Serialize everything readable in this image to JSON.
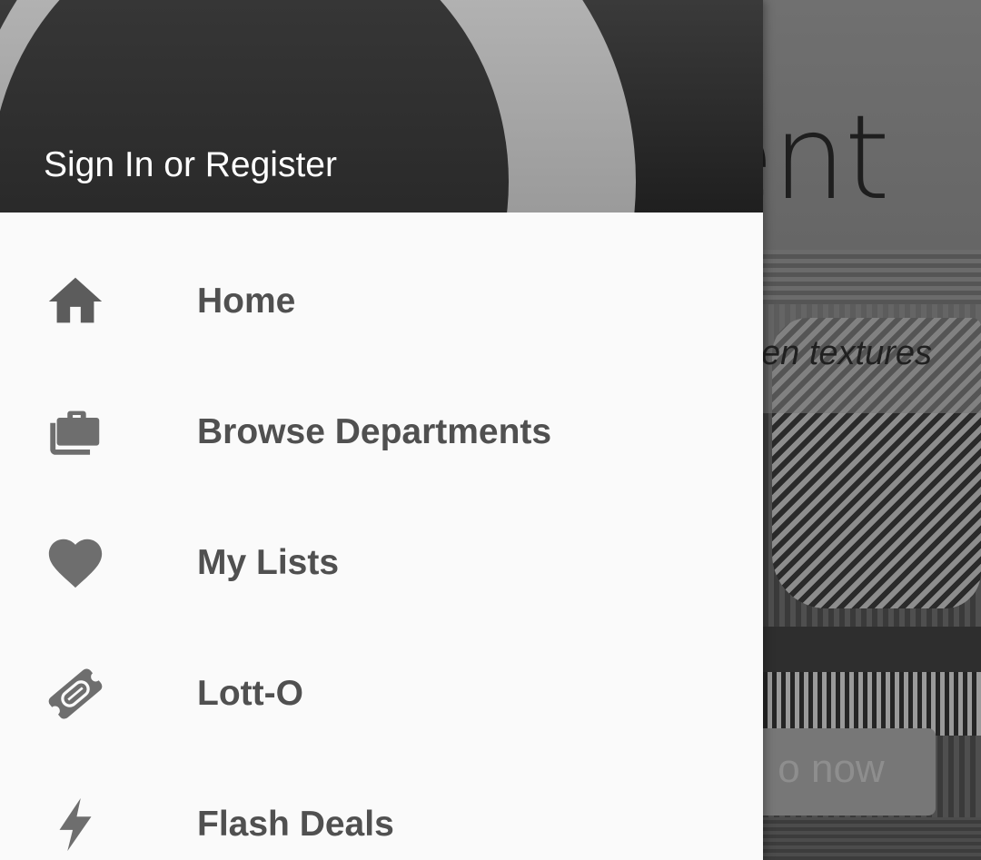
{
  "drawer": {
    "header": {
      "signin_label": "Sign In or Register"
    },
    "items": [
      {
        "label": "Home",
        "icon": "home-icon"
      },
      {
        "label": "Browse Departments",
        "icon": "briefcase-icon"
      },
      {
        "label": "My Lists",
        "icon": "heart-icon"
      },
      {
        "label": "Lott-O",
        "icon": "ticket-icon"
      },
      {
        "label": "Flash Deals",
        "icon": "lightning-icon"
      }
    ]
  },
  "background": {
    "banner_text": "vent",
    "caption": "en textures",
    "cta_label": "o now"
  },
  "colors": {
    "drawer_bg": "#fafafa",
    "menu_text": "#505050",
    "icon": "#6e6e6e",
    "header_text": "#ffffff"
  }
}
